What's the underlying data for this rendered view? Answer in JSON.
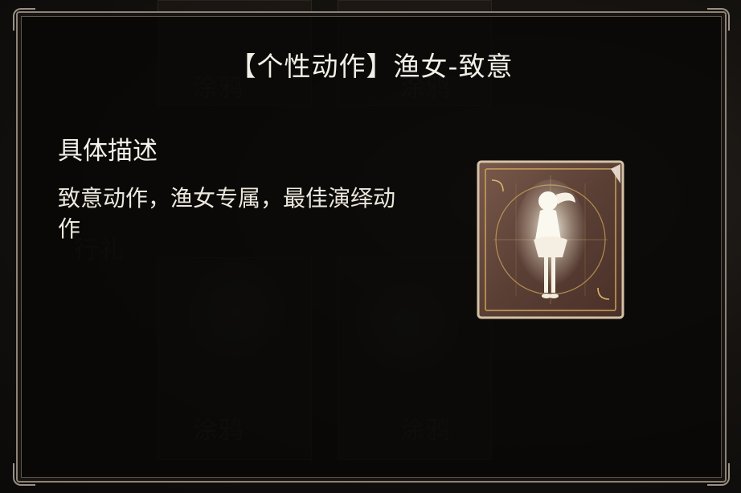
{
  "dialog": {
    "title": "【个性动作】渔女-致意",
    "section_heading": "具体描述",
    "description": "致意动作，渔女专属，最佳演绎动作"
  },
  "item": {
    "icon": "emote-figure-icon"
  },
  "background": {
    "labels": [
      "涂鸦",
      "涂鸦",
      "行礼",
      "涂鸦",
      "涂鸦"
    ]
  }
}
